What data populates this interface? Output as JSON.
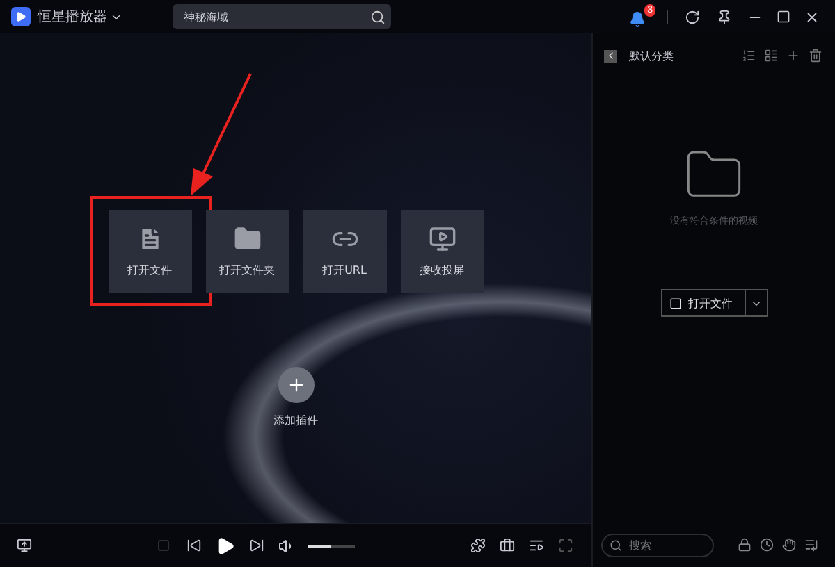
{
  "app": {
    "title": "恒星播放器"
  },
  "search": {
    "value": "神秘海域"
  },
  "notifications": {
    "badge": "3"
  },
  "actions": [
    {
      "label": "打开文件",
      "kind": "file",
      "highlighted": true
    },
    {
      "label": "打开文件夹",
      "kind": "folder",
      "highlighted": false
    },
    {
      "label": "打开URL",
      "kind": "url",
      "highlighted": false
    },
    {
      "label": "接收投屏",
      "kind": "cast",
      "highlighted": false
    }
  ],
  "add_plugin": {
    "label": "添加插件"
  },
  "sidebar": {
    "title": "默认分类",
    "empty_message": "没有符合条件的视频",
    "open_button": "打开文件",
    "search": {
      "placeholder": "搜索"
    }
  },
  "player": {
    "volume": {
      "level": 0.5
    }
  }
}
